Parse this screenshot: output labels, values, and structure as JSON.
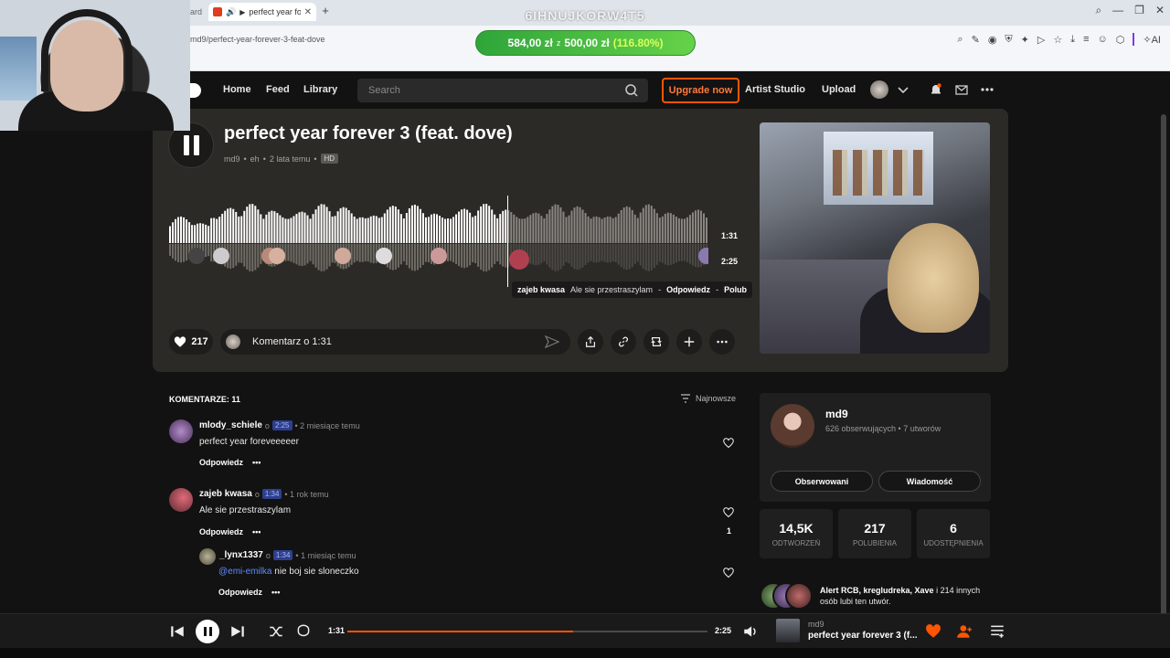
{
  "browser": {
    "tab_left_fragment": "ard",
    "tab_title": "perfect year foreve",
    "url": "md9/perfect-year-forever-3-feat-dove",
    "overlay_code": "6IHNUJKORW4T5",
    "donation": {
      "current": "584,00 zł",
      "sep": "z",
      "goal": "500,00 zł",
      "pct": "(116.80%)"
    }
  },
  "nav": {
    "home": "Home",
    "feed": "Feed",
    "library": "Library",
    "search_placeholder": "Search",
    "upgrade": "Upgrade now",
    "artist_studio": "Artist Studio",
    "upload": "Upload"
  },
  "track": {
    "title": "perfect year forever 3 (feat. dove)",
    "artist": "md9",
    "genre": "eh",
    "age": "2 lata temu",
    "badge": "HD",
    "time_current": "1:31",
    "time_duration": "2:25",
    "progress_fraction": 0.628,
    "likes": "217",
    "comment_prompt": "Komentarz o 1:31",
    "tooltip": {
      "user": "zajeb kwasa",
      "text": "Ale sie przestraszylam",
      "reply": "Odpowiedz",
      "like": "Polub"
    }
  },
  "comments": {
    "header": "KOMENTARZE: 11",
    "sort": "Najnowsze",
    "items": [
      {
        "user": "mlody_schiele",
        "at": "o",
        "ts": "2:25",
        "age": "• 2 miesiące temu",
        "text": "perfect year foreveeeeer",
        "reply": "Odpowiedz",
        "likes": ""
      },
      {
        "user": "zajeb kwasa",
        "at": "o",
        "ts": "1:34",
        "age": "• 1 rok temu",
        "text": "Ale sie przestraszylam",
        "reply": "Odpowiedz",
        "likes": "1"
      },
      {
        "user": "_lynx1337",
        "at": "o",
        "ts": "1:34",
        "age": "• 1 miesiąc temu",
        "mention": "@emi-emilka",
        "text": " nie boj sie sloneczko",
        "reply": "Odpowiedz",
        "likes": ""
      }
    ]
  },
  "artist": {
    "name": "md9",
    "sub": "626 obserwujących • 7 utworów",
    "follow": "Obserwowani",
    "message": "Wiadomość"
  },
  "stats": [
    {
      "value": "14,5K",
      "label": "ODTWORZEŃ"
    },
    {
      "value": "217",
      "label": "POLUBIENIA"
    },
    {
      "value": "6",
      "label": "UDOSTĘPNIENIA"
    }
  ],
  "likers": {
    "names": "Alert RCB, kregludreka, Xave",
    "rest": " i 214 innych osób lubi ten utwór."
  },
  "player": {
    "current": "1:31",
    "duration": "2:25",
    "artist": "md9",
    "title": "perfect year forever 3 (f..."
  },
  "colors": {
    "accent": "#ff5500",
    "background": "#121212",
    "hero": "#2c2a26",
    "timestamp_badge": "#2d3f8c"
  }
}
